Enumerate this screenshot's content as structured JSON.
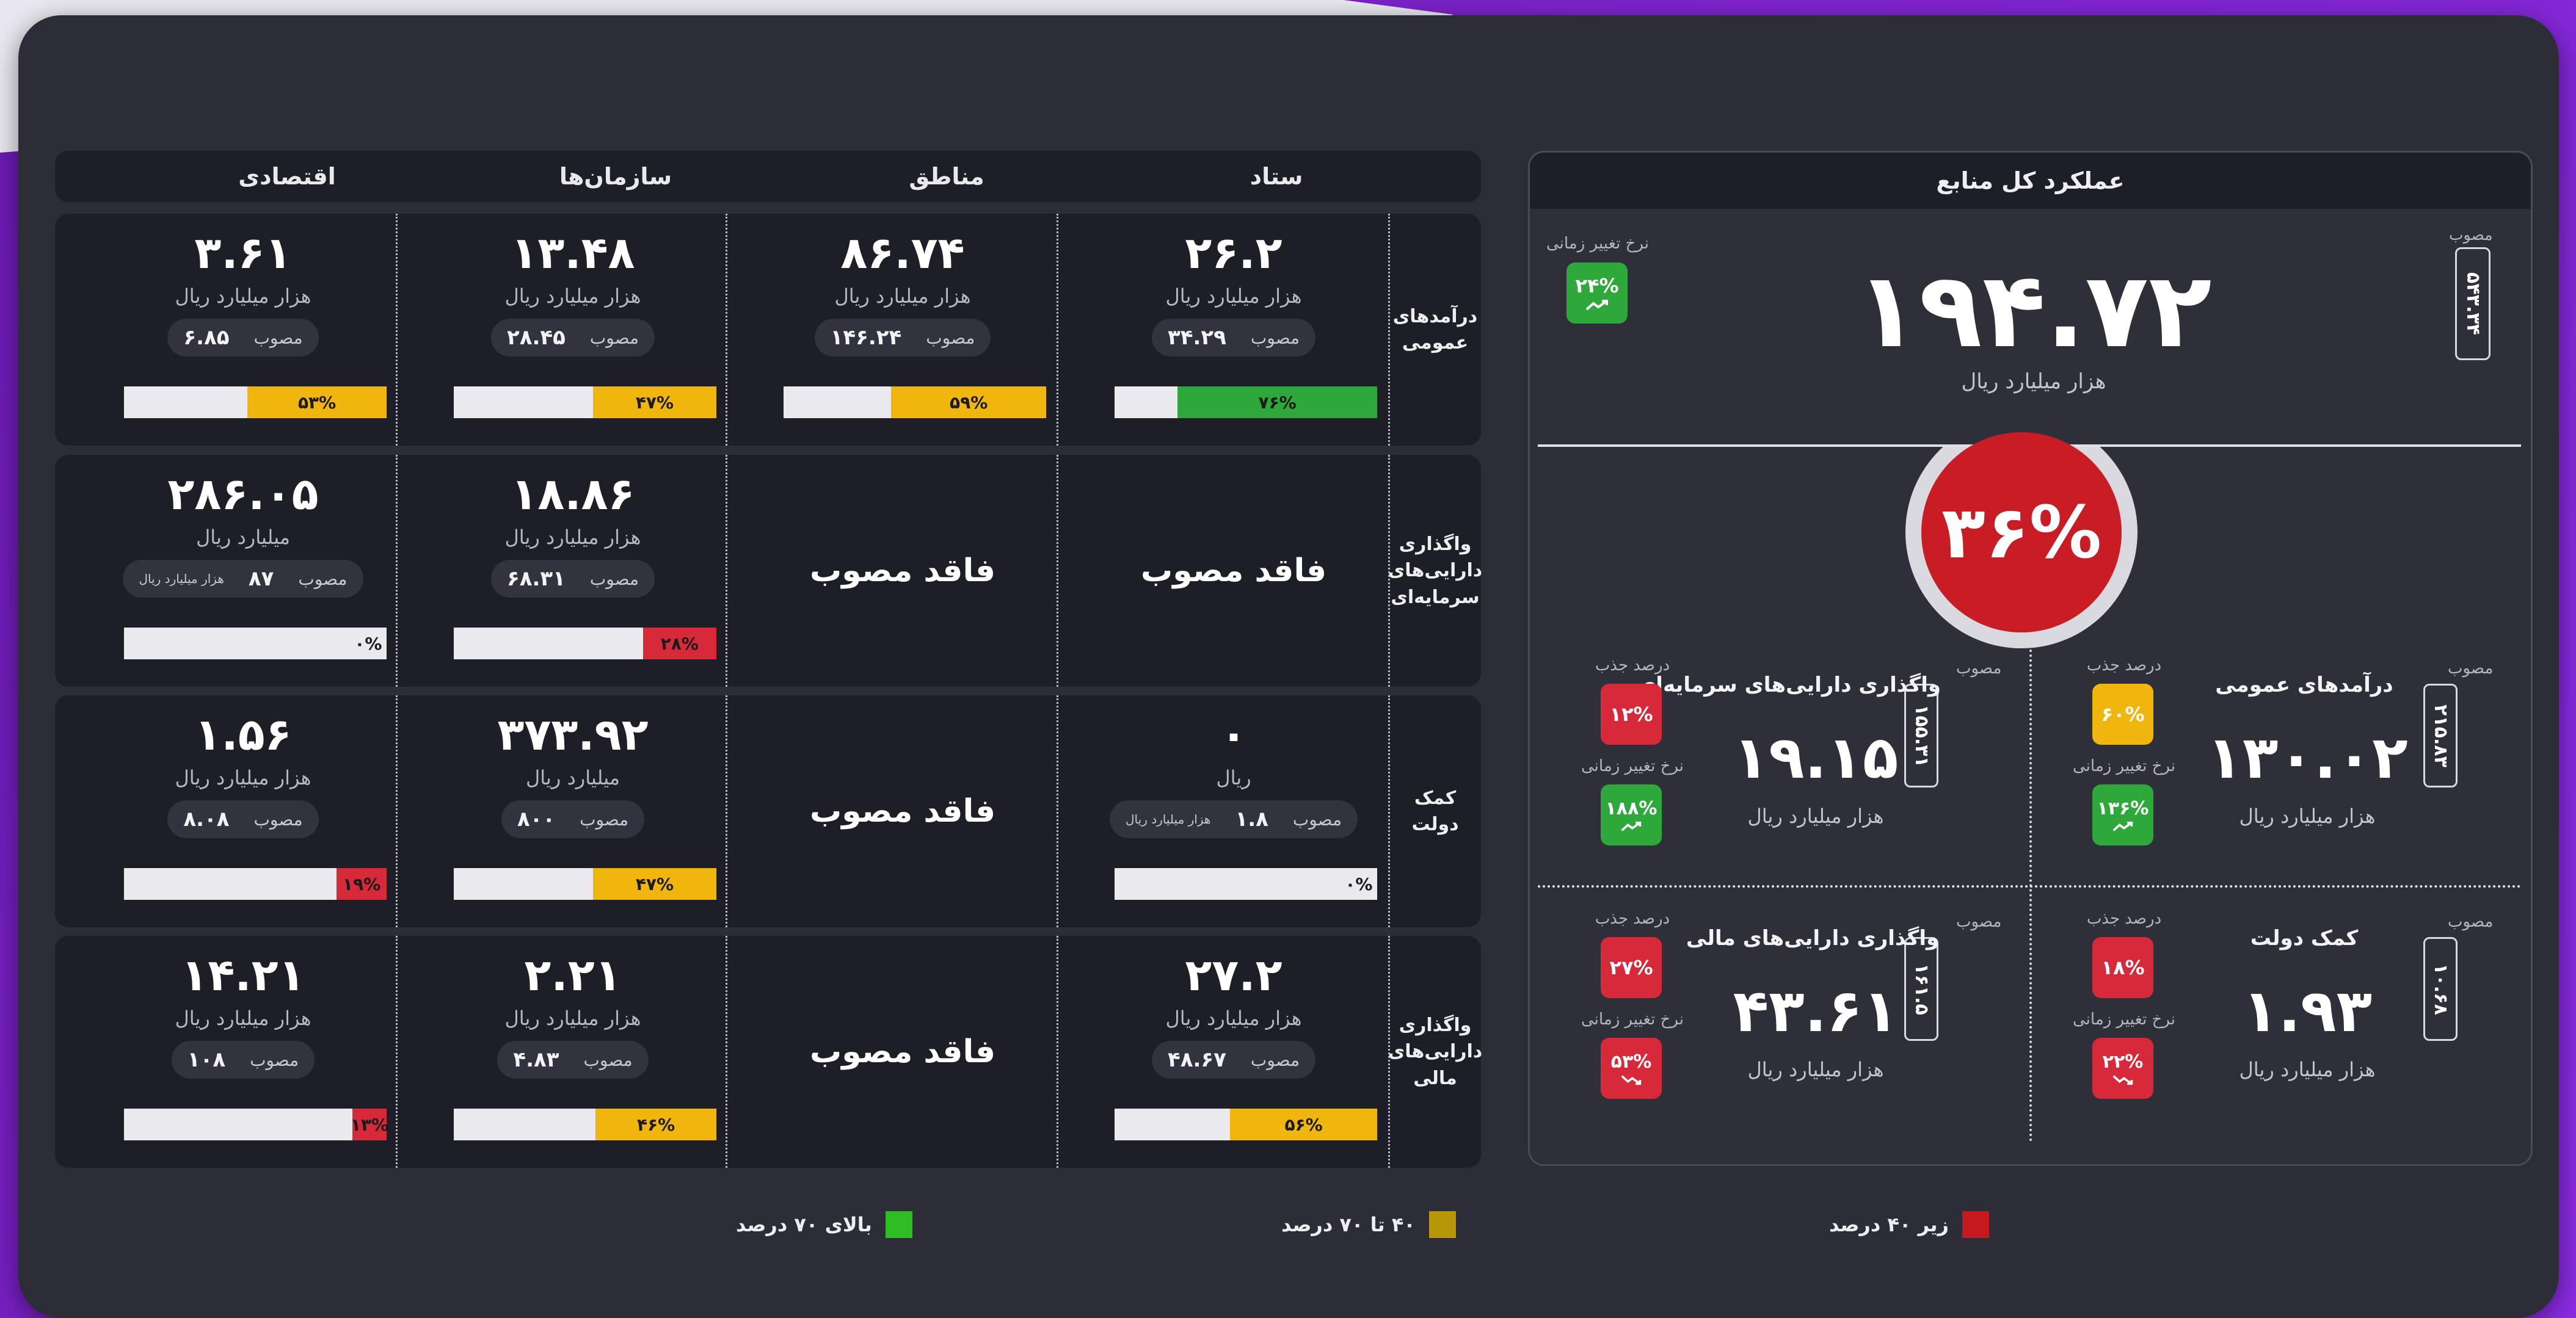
{
  "colors": {
    "green": "#2ea83a",
    "yellow": "#f1b60d",
    "red": "#d6293a",
    "panel": "#2d2d38",
    "cell": "#1e1e27",
    "accent_purple": "#7b22c8"
  },
  "matrix": {
    "columns": [
      "ستاد",
      "مناطق",
      "سازمان‌ها",
      "اقتصادی"
    ],
    "approved_label": "مصوب",
    "no_approval_label": "فاقد مصوب",
    "rows": [
      {
        "label": "درآمدهای عمومی",
        "cells": [
          {
            "value": "۲۶.۲",
            "unit": "هزار میلیارد ریال",
            "approved": "۳۴.۲۹",
            "percent": 76,
            "percent_text": "۷۶%",
            "status": "green"
          },
          {
            "value": "۸۶.۷۴",
            "unit": "هزار میلیارد ریال",
            "approved": "۱۴۶.۲۴",
            "percent": 59,
            "percent_text": "۵۹%",
            "status": "yellow"
          },
          {
            "value": "۱۳.۴۸",
            "unit": "هزار میلیارد ریال",
            "approved": "۲۸.۴۵",
            "percent": 47,
            "percent_text": "۴۷%",
            "status": "yellow"
          },
          {
            "value": "۳.۶۱",
            "unit": "هزار میلیارد ریال",
            "approved": "۶.۸۵",
            "percent": 53,
            "percent_text": "۵۳%",
            "status": "yellow"
          }
        ]
      },
      {
        "label": "واگذاری دارایی‌های سرمایه‌ای",
        "cells": [
          {
            "no_approval": true
          },
          {
            "no_approval": true
          },
          {
            "value": "۱۸.۸۶",
            "unit": "هزار میلیارد ریال",
            "approved": "۶۸.۳۱",
            "percent": 28,
            "percent_text": "۲۸%",
            "status": "red"
          },
          {
            "value": "۲۸۶.۰۵",
            "unit": "میلیارد ریال",
            "approved": "۸۷",
            "approved_unit": "هزار میلیارد ریال",
            "percent": 0,
            "percent_text": "۰%",
            "status": "red"
          }
        ]
      },
      {
        "label": "کمک دولت",
        "cells": [
          {
            "value": "۰",
            "unit": "ریال",
            "approved": "۱.۸",
            "approved_unit": "هزار میلیارد ریال",
            "percent": 0,
            "percent_text": "۰%",
            "status": "red"
          },
          {
            "no_approval": true
          },
          {
            "value": "۳۷۳.۹۲",
            "unit": "میلیارد ریال",
            "approved": "۸۰۰",
            "percent": 47,
            "percent_text": "۴۷%",
            "status": "yellow"
          },
          {
            "value": "۱.۵۶",
            "unit": "هزار میلیارد ریال",
            "approved": "۸.۰۸",
            "percent": 19,
            "percent_text": "۱۹%",
            "status": "red"
          }
        ]
      },
      {
        "label": "واگذاری دارایی‌های مالی",
        "cells": [
          {
            "value": "۲۷.۲",
            "unit": "هزار میلیارد ریال",
            "approved": "۴۸.۶۷",
            "percent": 56,
            "percent_text": "۵۶%",
            "status": "yellow"
          },
          {
            "no_approval": true
          },
          {
            "value": "۲.۲۱",
            "unit": "هزار میلیارد ریال",
            "approved": "۴.۸۳",
            "percent": 46,
            "percent_text": "۴۶%",
            "status": "yellow"
          },
          {
            "value": "۱۴.۲۱",
            "unit": "هزار میلیارد ریال",
            "approved": "۱۰۸",
            "percent": 13,
            "percent_text": "۱۳%",
            "status": "red"
          }
        ]
      }
    ]
  },
  "summary": {
    "title": "عملکرد کل منابع",
    "total": {
      "value": "۱۹۴.۷۲",
      "unit": "هزار میلیارد ریال",
      "approved_label": "مصوب",
      "approved": "۵۴۳.۳۴",
      "trend_label": "نرخ تغییر زمانی",
      "trend": "۲۴%",
      "trend_dir": "up",
      "trend_status": "green"
    },
    "gauge": {
      "percent": 36,
      "text": "۳۶%"
    },
    "quadrants": [
      {
        "title": "درآمدهای عمومی",
        "value": "۱۳۰.۰۲",
        "unit": "هزار میلیارد ریال",
        "approved_label": "مصوب",
        "approved": "۲۱۵.۸۳",
        "absorb_label": "درصد جذب",
        "absorb": "۶۰%",
        "absorb_status": "yellow",
        "trend_label": "نرخ تغییر زمانی",
        "trend": "۱۳۶%",
        "trend_dir": "up",
        "trend_status": "green"
      },
      {
        "title": "واگذاری دارایی‌های سرمایه‌ای",
        "value": "۱۹.۱۵",
        "unit": "هزار میلیارد ریال",
        "approved_label": "مصوب",
        "approved": "۱۵۵.۳۱",
        "absorb_label": "درصد جذب",
        "absorb": "۱۲%",
        "absorb_status": "red",
        "trend_label": "نرخ تغییر زمانی",
        "trend": "۱۸۸%",
        "trend_dir": "up",
        "trend_status": "green"
      },
      {
        "title": "کمک دولت",
        "value": "۱.۹۳",
        "unit": "هزار میلیارد ریال",
        "approved_label": "مصوب",
        "approved": "۱۰.۶۸",
        "absorb_label": "درصد جذب",
        "absorb": "۱۸%",
        "absorb_status": "red",
        "trend_label": "نرخ تغییر زمانی",
        "trend": "۲۲%",
        "trend_dir": "down",
        "trend_status": "red"
      },
      {
        "title": "واگذاری دارایی‌های مالی",
        "value": "۴۳.۶۱",
        "unit": "هزار میلیارد ریال",
        "approved_label": "مصوب",
        "approved": "۱۶۱.۵",
        "absorb_label": "درصد جذب",
        "absorb": "۲۷%",
        "absorb_status": "red",
        "trend_label": "نرخ تغییر زمانی",
        "trend": "۵۳%",
        "trend_dir": "down",
        "trend_status": "red"
      }
    ]
  },
  "legend": [
    {
      "label": "زیر ۴۰ درصد",
      "color": "#c41a1e"
    },
    {
      "label": "۴۰ تا ۷۰ درصد",
      "color": "#b8960a"
    },
    {
      "label": "بالای ۷۰ درصد",
      "color": "#2ebd22"
    }
  ]
}
